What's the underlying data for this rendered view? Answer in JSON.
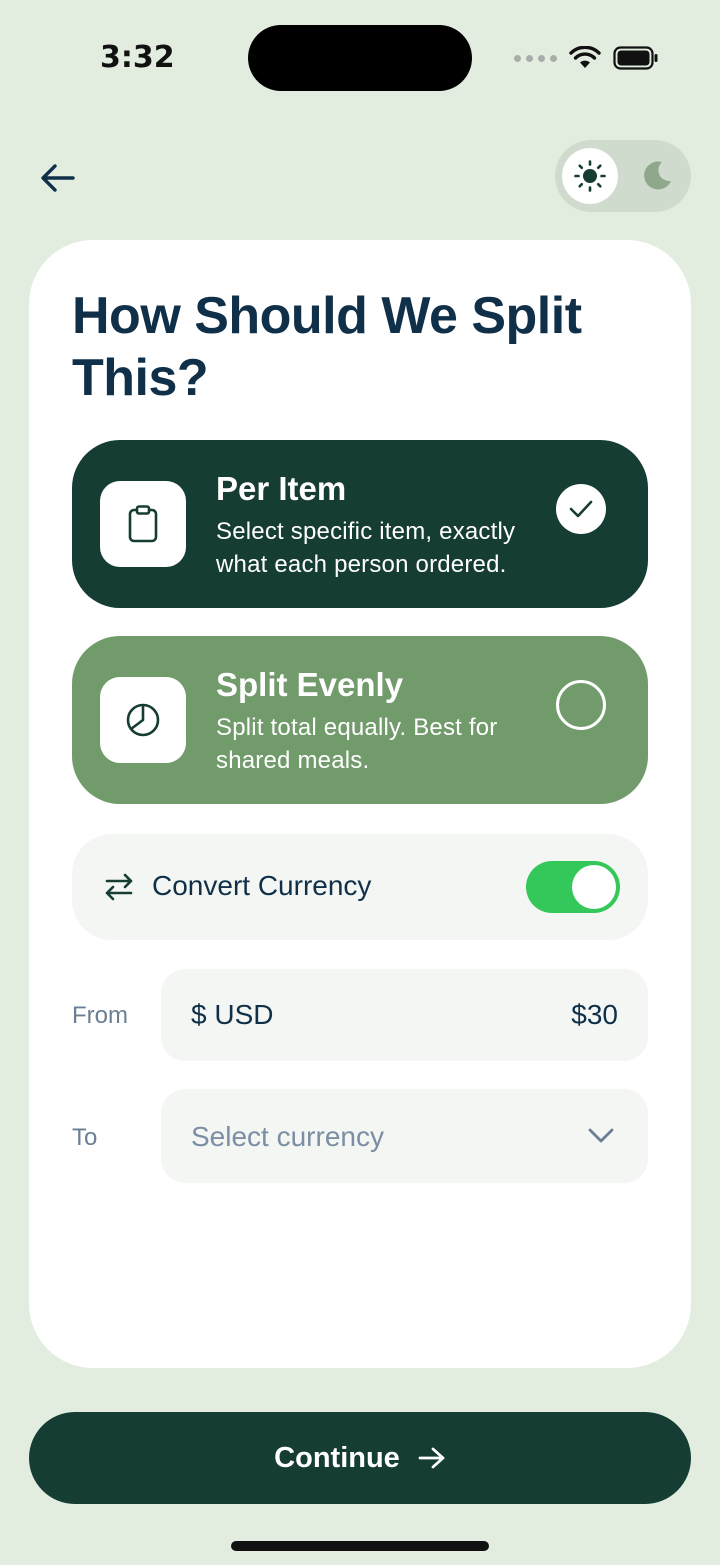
{
  "status_bar": {
    "time": "3:32"
  },
  "header": {
    "back_icon": "arrow-left-icon",
    "theme_toggle": {
      "active": "light",
      "light_icon": "sun-icon",
      "dark_icon": "moon-icon"
    }
  },
  "page": {
    "title": "How Should We Split This?"
  },
  "options": [
    {
      "title": "Per Item",
      "description": "Select specific item, exactly what each person ordered.",
      "icon": "clipboard-icon",
      "selected": true
    },
    {
      "title": "Split Evenly",
      "description": "Split total equally. Best for shared meals.",
      "icon": "pie-chart-icon",
      "selected": false
    }
  ],
  "convert": {
    "label": "Convert Currency",
    "icon": "swap-arrows-icon",
    "enabled": true
  },
  "from": {
    "label": "From",
    "currency": "$ USD",
    "amount": "$30"
  },
  "to": {
    "label": "To",
    "placeholder": "Select currency",
    "icon": "chevron-down-icon"
  },
  "continue_button": {
    "label": "Continue",
    "icon": "arrow-right-icon"
  },
  "colors": {
    "background": "#e2ede0",
    "primary_dark": "#163d33",
    "option_secondary": "#719b6b",
    "title_text": "#10304a",
    "toggle_on": "#34c759"
  }
}
